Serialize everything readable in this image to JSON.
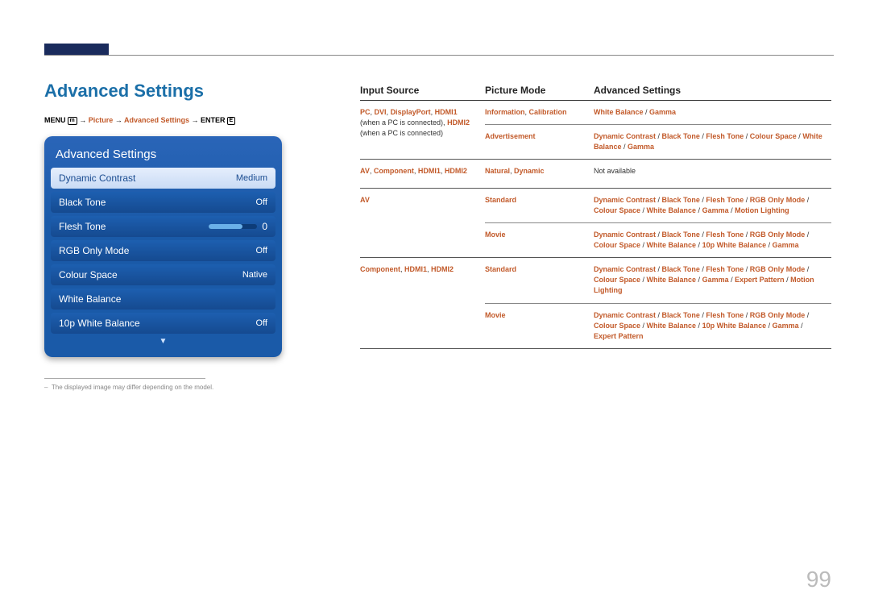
{
  "page_number": "99",
  "section_title": "Advanced Settings",
  "breadcrumb": {
    "prefix": "MENU",
    "icon1": "m",
    "arrow": " → ",
    "p1": "Picture",
    "p2": "Advanced Settings",
    "suffix": "ENTER",
    "icon2": "E"
  },
  "osd": {
    "title": "Advanced Settings",
    "rows": [
      {
        "label": "Dynamic Contrast",
        "value": "Medium",
        "selected": true
      },
      {
        "label": "Black Tone",
        "value": "Off"
      },
      {
        "label": "Flesh Tone",
        "value": "0",
        "slider": true
      },
      {
        "label": "RGB Only Mode",
        "value": "Off"
      },
      {
        "label": "Colour Space",
        "value": "Native"
      },
      {
        "label": "White Balance",
        "value": ""
      },
      {
        "label": "10p White Balance",
        "value": "Off"
      }
    ]
  },
  "footnote": "The displayed image may differ depending on the model.",
  "table": {
    "headers": {
      "c1": "Input Source",
      "c2": "Picture Mode",
      "c3": "Advanced Settings"
    },
    "rows": [
      {
        "c1": [
          {
            "t": "PC",
            "hl": true,
            "b": true
          },
          {
            "t": ", "
          },
          {
            "t": "DVI",
            "hl": true,
            "b": true
          },
          {
            "t": ", "
          },
          {
            "t": "DisplayPort",
            "hl": true,
            "b": true
          },
          {
            "t": ", "
          },
          {
            "t": "HDMI1",
            "hl": true,
            "b": true
          },
          {
            "t": " (when a PC is connected), "
          },
          {
            "t": "HDMI2",
            "hl": true,
            "b": true
          },
          {
            "t": " (when a PC is connected)"
          }
        ],
        "c2": [
          {
            "t": "Information",
            "hl": true,
            "b": true
          },
          {
            "t": ", "
          },
          {
            "t": "Calibration",
            "hl": true,
            "b": true
          }
        ],
        "c3": [
          {
            "t": "White Balance",
            "hl": true,
            "b": true
          },
          {
            "t": " / "
          },
          {
            "t": "Gamma",
            "hl": true,
            "b": true
          }
        ],
        "top": true
      },
      {
        "c1": [],
        "c2": [
          {
            "t": "Advertisement",
            "hl": true,
            "b": true
          }
        ],
        "c3": [
          {
            "t": "Dynamic Contrast",
            "hl": true,
            "b": true
          },
          {
            "t": " / "
          },
          {
            "t": "Black Tone",
            "hl": true,
            "b": true
          },
          {
            "t": " / "
          },
          {
            "t": "Flesh Tone",
            "hl": true,
            "b": true
          },
          {
            "t": " / "
          },
          {
            "t": "Colour Space",
            "hl": true,
            "b": true
          },
          {
            "t": " / "
          },
          {
            "t": "White Balance",
            "hl": true,
            "b": true
          },
          {
            "t": " / "
          },
          {
            "t": "Gamma",
            "hl": true,
            "b": true
          }
        ],
        "inner": true
      },
      {
        "c1": [
          {
            "t": "AV",
            "hl": true,
            "b": true
          },
          {
            "t": ", "
          },
          {
            "t": "Component",
            "hl": true,
            "b": true
          },
          {
            "t": ", "
          },
          {
            "t": "HDMI1",
            "hl": true,
            "b": true
          },
          {
            "t": ", "
          },
          {
            "t": "HDMI2",
            "hl": true,
            "b": true
          }
        ],
        "c2": [
          {
            "t": "Natural",
            "hl": true,
            "b": true
          },
          {
            "t": ", "
          },
          {
            "t": "Dynamic",
            "hl": true,
            "b": true
          }
        ],
        "c3": [
          {
            "t": "Not available"
          }
        ]
      },
      {
        "c1": [
          {
            "t": "AV",
            "hl": true,
            "b": true
          }
        ],
        "c2": [
          {
            "t": "Standard",
            "hl": true,
            "b": true
          }
        ],
        "c3": [
          {
            "t": "Dynamic Contrast",
            "hl": true,
            "b": true
          },
          {
            "t": " / "
          },
          {
            "t": "Black Tone",
            "hl": true,
            "b": true
          },
          {
            "t": " / "
          },
          {
            "t": "Flesh Tone",
            "hl": true,
            "b": true
          },
          {
            "t": " / "
          },
          {
            "t": "RGB Only Mode",
            "hl": true,
            "b": true
          },
          {
            "t": " / "
          },
          {
            "t": "Colour Space",
            "hl": true,
            "b": true
          },
          {
            "t": " / "
          },
          {
            "t": "White Balance",
            "hl": true,
            "b": true
          },
          {
            "t": " / "
          },
          {
            "t": "Gamma",
            "hl": true,
            "b": true
          },
          {
            "t": " / "
          },
          {
            "t": "Motion Lighting",
            "hl": true,
            "b": true
          }
        ],
        "top": true
      },
      {
        "c1": [],
        "c2": [
          {
            "t": "Movie",
            "hl": true,
            "b": true
          }
        ],
        "c3": [
          {
            "t": "Dynamic Contrast",
            "hl": true,
            "b": true
          },
          {
            "t": " / "
          },
          {
            "t": "Black Tone",
            "hl": true,
            "b": true
          },
          {
            "t": " / "
          },
          {
            "t": "Flesh Tone",
            "hl": true,
            "b": true
          },
          {
            "t": " / "
          },
          {
            "t": "RGB Only Mode",
            "hl": true,
            "b": true
          },
          {
            "t": " / "
          },
          {
            "t": "Colour Space",
            "hl": true,
            "b": true
          },
          {
            "t": " / "
          },
          {
            "t": "White Balance",
            "hl": true,
            "b": true
          },
          {
            "t": " / "
          },
          {
            "t": "10p White Balance",
            "hl": true,
            "b": true
          },
          {
            "t": " / "
          },
          {
            "t": "Gamma",
            "hl": true,
            "b": true
          }
        ],
        "inner": true
      },
      {
        "c1": [
          {
            "t": "Component",
            "hl": true,
            "b": true
          },
          {
            "t": ", "
          },
          {
            "t": "HDMI1",
            "hl": true,
            "b": true
          },
          {
            "t": ", "
          },
          {
            "t": "HDMI2",
            "hl": true,
            "b": true
          }
        ],
        "c2": [
          {
            "t": "Standard",
            "hl": true,
            "b": true
          }
        ],
        "c3": [
          {
            "t": "Dynamic Contrast",
            "hl": true,
            "b": true
          },
          {
            "t": " / "
          },
          {
            "t": "Black Tone",
            "hl": true,
            "b": true
          },
          {
            "t": " / "
          },
          {
            "t": "Flesh Tone",
            "hl": true,
            "b": true
          },
          {
            "t": " / "
          },
          {
            "t": "RGB Only Mode",
            "hl": true,
            "b": true
          },
          {
            "t": " / "
          },
          {
            "t": "Colour Space",
            "hl": true,
            "b": true
          },
          {
            "t": " / "
          },
          {
            "t": "White Balance",
            "hl": true,
            "b": true
          },
          {
            "t": " / "
          },
          {
            "t": "Gamma",
            "hl": true,
            "b": true
          },
          {
            "t": " / "
          },
          {
            "t": "Expert Pattern",
            "hl": true,
            "b": true
          },
          {
            "t": " / "
          },
          {
            "t": "Motion Lighting",
            "hl": true,
            "b": true
          }
        ],
        "top": true
      },
      {
        "c1": [],
        "c2": [
          {
            "t": "Movie",
            "hl": true,
            "b": true
          }
        ],
        "c3": [
          {
            "t": "Dynamic Contrast",
            "hl": true,
            "b": true
          },
          {
            "t": " / "
          },
          {
            "t": "Black Tone",
            "hl": true,
            "b": true
          },
          {
            "t": " / "
          },
          {
            "t": "Flesh Tone",
            "hl": true,
            "b": true
          },
          {
            "t": " / "
          },
          {
            "t": "RGB Only Mode",
            "hl": true,
            "b": true
          },
          {
            "t": " / "
          },
          {
            "t": "Colour Space",
            "hl": true,
            "b": true
          },
          {
            "t": " / "
          },
          {
            "t": "White Balance",
            "hl": true,
            "b": true
          },
          {
            "t": " / "
          },
          {
            "t": "10p White Balance",
            "hl": true,
            "b": true
          },
          {
            "t": " / "
          },
          {
            "t": "Gamma",
            "hl": true,
            "b": true
          },
          {
            "t": " / "
          },
          {
            "t": "Expert Pattern",
            "hl": true,
            "b": true
          }
        ],
        "inner": true
      }
    ]
  }
}
